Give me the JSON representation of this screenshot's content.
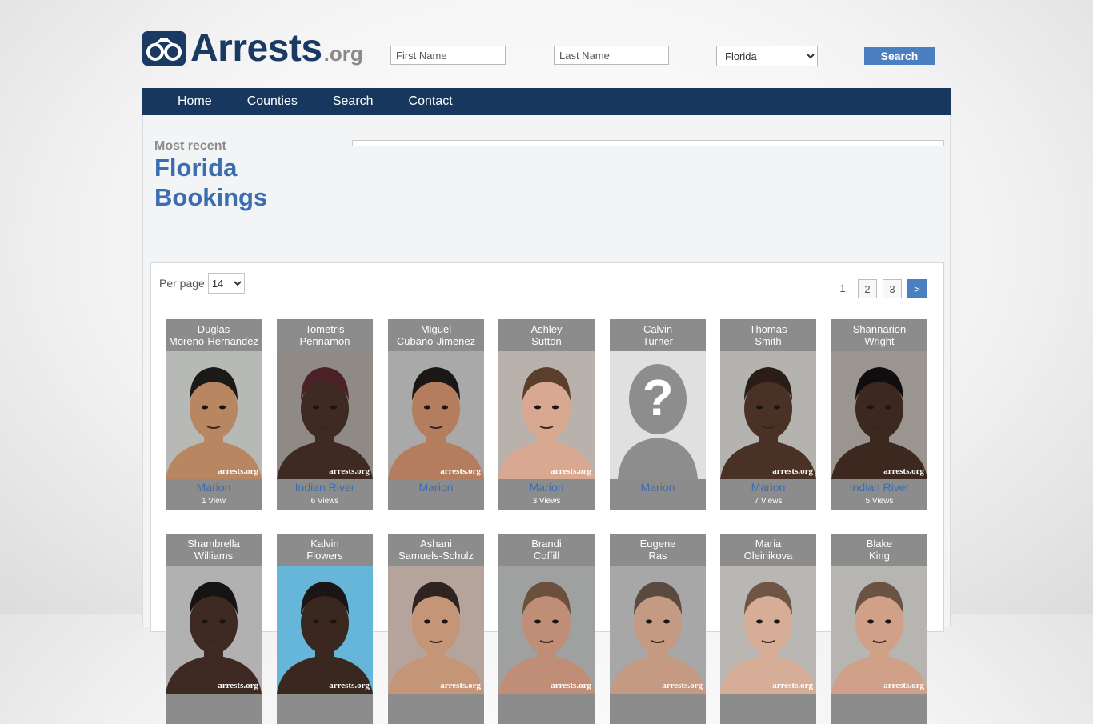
{
  "header": {
    "logo_text": "Arrests",
    "logo_suffix": ".org",
    "first_name_placeholder": "First Name",
    "last_name_placeholder": "Last Name",
    "state_selected": "Florida",
    "search_label": "Search"
  },
  "nav": {
    "items": [
      "Home",
      "Counties",
      "Search",
      "Contact"
    ]
  },
  "intro": {
    "most_recent": "Most recent",
    "title_line1": "Florida",
    "title_line2": "Bookings"
  },
  "listing": {
    "per_page_label": "Per page",
    "per_page_value": "14",
    "pages": [
      "1",
      "2",
      "3",
      ">"
    ],
    "watermark": "arrests.org",
    "row1": [
      {
        "first": "Duglas",
        "last": "Moreno-Hernandez",
        "county": "Marion",
        "views": "1 View",
        "skin": "#b88660",
        "bg": "#b7b9b6",
        "hair": "#1c1a19"
      },
      {
        "first": "Tometris",
        "last": "Pennamon",
        "county": "Indian River",
        "views": "6 Views",
        "skin": "#3e2a22",
        "bg": "#8f8a86",
        "hair": "#4a2226"
      },
      {
        "first": "Miguel",
        "last": "Cubano-Jimenez",
        "county": "Marion",
        "views": "",
        "skin": "#b47d5e",
        "bg": "#a9a9a9",
        "hair": "#1a1716"
      },
      {
        "first": "Ashley",
        "last": "Sutton",
        "county": "Marion",
        "views": "3 Views",
        "skin": "#d8a890",
        "bg": "#b9b2ac",
        "hair": "#5a3f2c"
      },
      {
        "first": "Calvin",
        "last": "Turner",
        "county": "Marion",
        "views": "",
        "skin": "#8d8d8d",
        "bg": "#e0e0e0",
        "hair": "#8d8d8d"
      },
      {
        "first": "Thomas",
        "last": "Smith",
        "county": "Marion",
        "views": "7 Views",
        "skin": "#4a3126",
        "bg": "#b4b3b0",
        "hair": "#2a1d18"
      },
      {
        "first": "Shannarion",
        "last": "Wright",
        "county": "Indian River",
        "views": "5 Views",
        "skin": "#3d2820",
        "bg": "#9a9591",
        "hair": "#0f0d0d"
      }
    ],
    "row2": [
      {
        "first": "Shambrella",
        "last": "Williams",
        "skin": "#3e2a22",
        "bg": "#b1b1b1",
        "hair": "#151313"
      },
      {
        "first": "Kalvin",
        "last": "Flowers",
        "skin": "#3a2820",
        "bg": "#66b6d9",
        "hair": "#1b1515"
      },
      {
        "first": "Ashani",
        "last": "Samuels-Schulz",
        "skin": "#c59577",
        "bg": "#b4a49c",
        "hair": "#2f2420"
      },
      {
        "first": "Brandi",
        "last": "Coffill",
        "skin": "#c08d76",
        "bg": "#9fa0a0",
        "hair": "#6a503d"
      },
      {
        "first": "Eugene",
        "last": "Ras",
        "skin": "#c49a82",
        "bg": "#a7a7a7",
        "hair": "#5b4a40"
      },
      {
        "first": "Maria",
        "last": "Oleinikova",
        "skin": "#d6ad96",
        "bg": "#b9b6b3",
        "hair": "#6f5644"
      },
      {
        "first": "Blake",
        "last": "King",
        "skin": "#d0a088",
        "bg": "#b6b5b2",
        "hair": "#6b5344"
      }
    ]
  }
}
